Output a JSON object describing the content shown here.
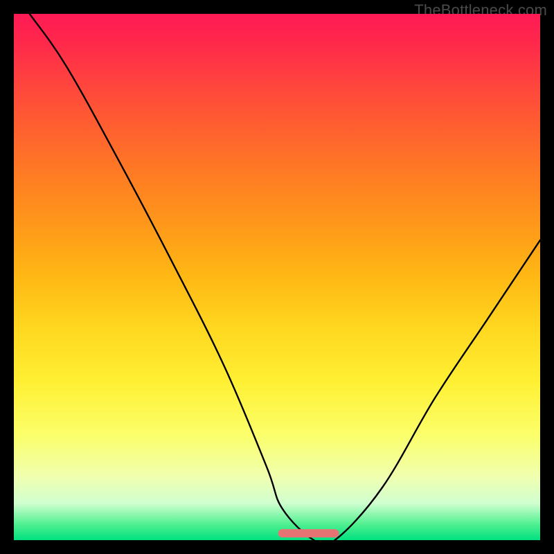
{
  "watermark": "TheBottleneck.com",
  "chart_data": {
    "type": "line",
    "title": "",
    "xlabel": "",
    "ylabel": "",
    "xlim": [
      0,
      100
    ],
    "ylim": [
      0,
      100
    ],
    "grid": false,
    "legend": false,
    "series": [
      {
        "name": "black-curve",
        "color": "#000000",
        "x": [
          3,
          10,
          20,
          30,
          40,
          48,
          51,
          57,
          61,
          70,
          80,
          90,
          100
        ],
        "values": [
          100,
          90,
          72,
          53,
          33,
          14,
          6,
          0,
          0,
          10,
          27,
          42,
          57
        ]
      },
      {
        "name": "flat-segment",
        "color": "#e57373",
        "x": [
          51,
          61
        ],
        "values": [
          1.3,
          1.3
        ]
      }
    ]
  }
}
